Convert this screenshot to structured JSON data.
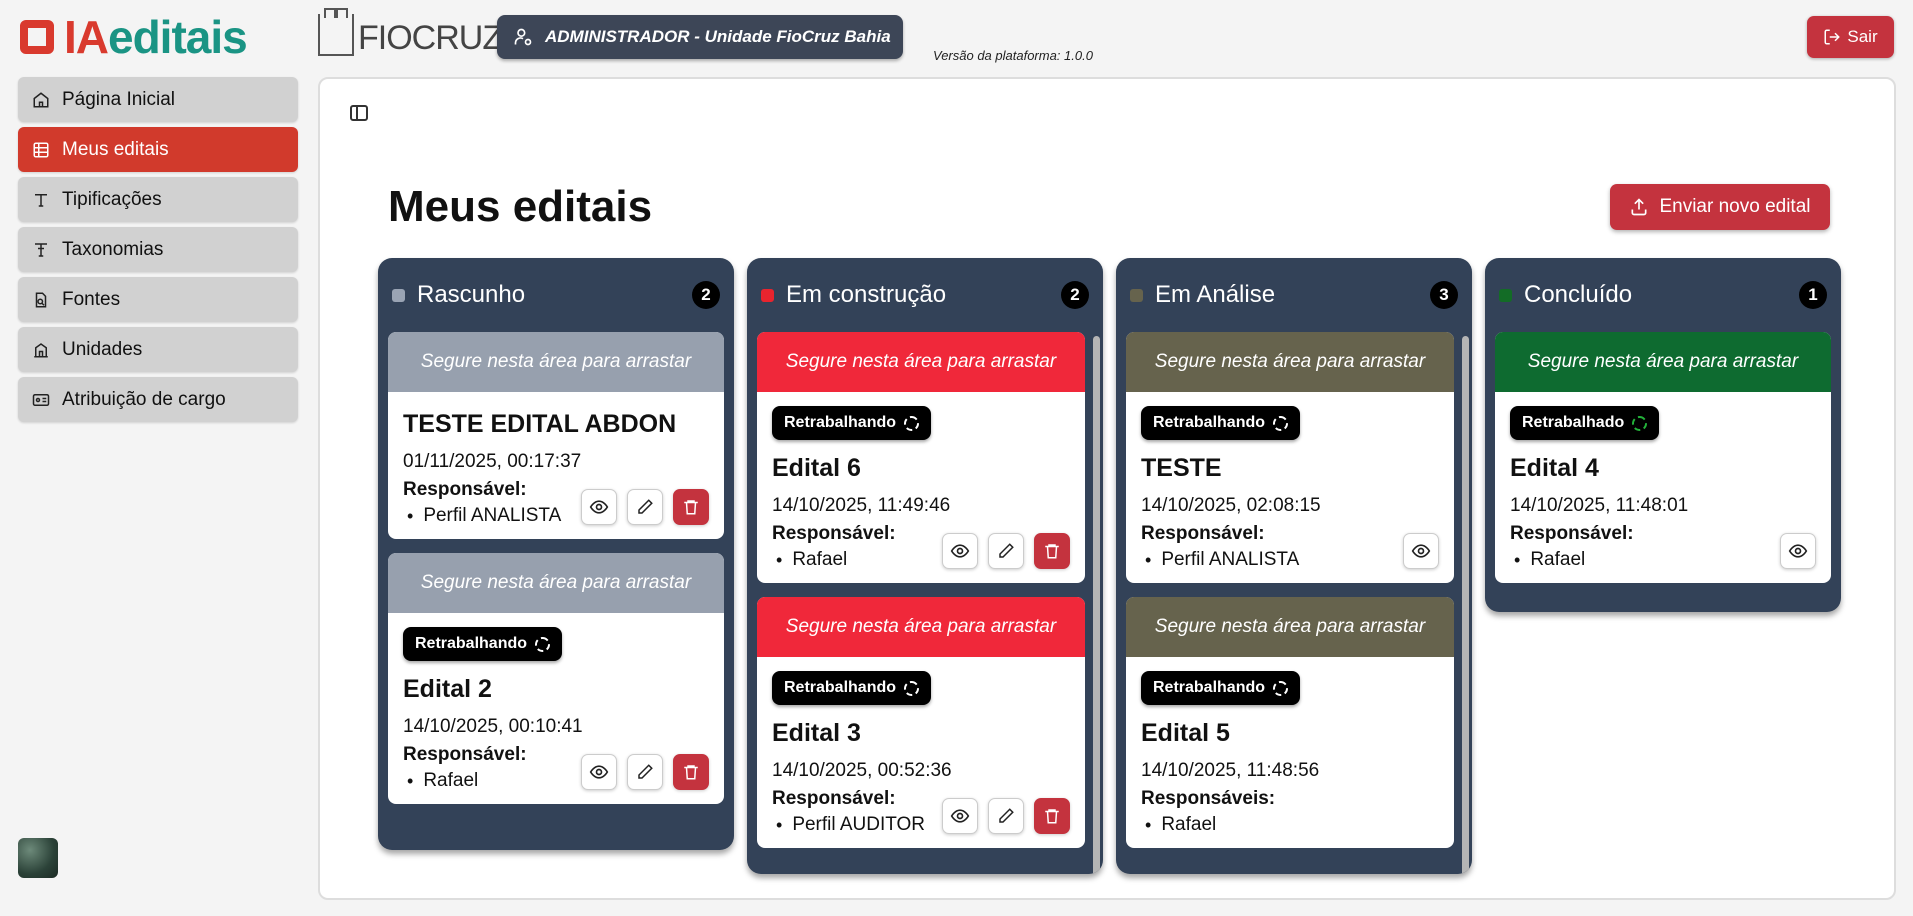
{
  "header": {
    "logo_prefix": "IA",
    "logo_suffix": "editais",
    "partner_logo": "FIOCRUZ",
    "admin_label": "ADMINISTRADOR - Unidade FioCruz Bahia",
    "version": "Versão da plataforma: 1.0.0",
    "logout_label": "Sair"
  },
  "sidebar": {
    "items": [
      {
        "label": "Página Inicial",
        "icon": "home-icon"
      },
      {
        "label": "Meus editais",
        "icon": "table-icon"
      },
      {
        "label": "Tipificações",
        "icon": "type-icon"
      },
      {
        "label": "Taxonomias",
        "icon": "taxonomy-icon"
      },
      {
        "label": "Fontes",
        "icon": "file-search-icon"
      },
      {
        "label": "Unidades",
        "icon": "building-icon"
      },
      {
        "label": "Atribuição de cargo",
        "icon": "id-card-icon"
      }
    ]
  },
  "main": {
    "title": "Meus editais",
    "send_label": "Enviar novo edital",
    "drag_hint": "Segure nesta área para arrastar",
    "columns": [
      {
        "title": "Rascunho",
        "count": "2",
        "dot_color": "#9aa4b4",
        "drag_color": "#97a0ae",
        "cards": [
          {
            "title": "TESTE EDITAL ABDON",
            "date": "01/11/2025, 00:17:37",
            "resp_label": "Responsável:",
            "person": "Perfil ANALISTA"
          },
          {
            "badge": "Retrabalhando",
            "title": "Edital 2",
            "date": "14/10/2025, 00:10:41",
            "resp_label": "Responsável:",
            "person": "Rafael"
          }
        ]
      },
      {
        "title": "Em construção",
        "count": "2",
        "dot_color": "#e8242e",
        "drag_color": "#f0283a",
        "cards": [
          {
            "badge": "Retrabalhando",
            "title": "Edital 6",
            "date": "14/10/2025, 11:49:46",
            "resp_label": "Responsável:",
            "person": "Rafael"
          },
          {
            "badge": "Retrabalhando",
            "title": "Edital 3",
            "date": "14/10/2025, 00:52:36",
            "resp_label": "Responsável:",
            "person": "Perfil AUDITOR"
          }
        ]
      },
      {
        "title": "Em Análise",
        "count": "3",
        "dot_color": "#66634d",
        "drag_color": "#66634d",
        "cards": [
          {
            "badge": "Retrabalhando",
            "title": "TESTE",
            "date": "14/10/2025, 02:08:15",
            "resp_label": "Responsável:",
            "person": "Perfil ANALISTA"
          },
          {
            "badge": "Retrabalhando",
            "title": "Edital 5",
            "date": "14/10/2025, 11:48:56",
            "resp_label": "Responsáveis:",
            "person": "Rafael"
          }
        ]
      },
      {
        "title": "Concluído",
        "count": "1",
        "dot_color": "#136c26",
        "drag_color": "#0e6b30",
        "cards": [
          {
            "badge": "Retrabalhado",
            "title": "Edital 4",
            "date": "14/10/2025, 11:48:01",
            "resp_label": "Responsável:",
            "person": "Rafael"
          }
        ]
      }
    ]
  }
}
